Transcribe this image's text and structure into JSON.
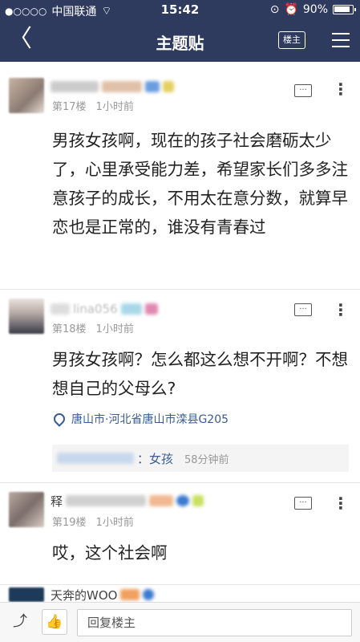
{
  "status": {
    "carrier": "中国联通",
    "time": "15:42",
    "battery": "90%"
  },
  "nav": {
    "title": "主题贴",
    "back_icon": "chevron-left-icon",
    "louzhu_label": "楼主",
    "menu_icon": "hamburger-menu-icon"
  },
  "posts": [
    {
      "floor": "第17楼",
      "time": "1小时前",
      "content": "男孩女孩啊，现在的孩子社会磨砺太少了，心里承受能力差，希望家长们多多注意孩子的成长，不用太在意分数，就算早恋也是正常的，谁没有青春过"
    },
    {
      "name_visible": "lina056",
      "floor": "第18楼",
      "time": "1小时前",
      "content": "男孩女孩啊？怎么都这么想不开啊？不想想自己的父母么?",
      "location": "唐山市·河北省唐山市滦县G205",
      "reply": {
        "name": "：女孩",
        "time": "58分钟前"
      }
    },
    {
      "name_visible": "释",
      "floor": "第19楼",
      "time": "1小时前",
      "content": "哎，这个社会啊"
    },
    {
      "name_visible": "天奔的WOO"
    }
  ],
  "bottom": {
    "share_icon": "share-icon",
    "like_icon": "thumbs-up-icon",
    "reply_placeholder": "回复楼主"
  },
  "colors": {
    "header_bg": "#2f3a5f",
    "link": "#3b5b94"
  }
}
